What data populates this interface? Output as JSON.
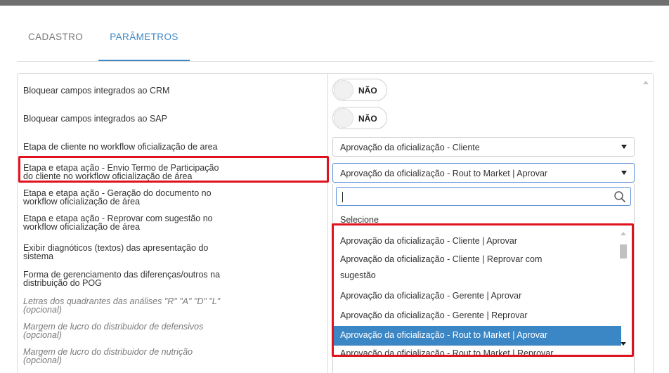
{
  "tabs": [
    {
      "label": "CADASTRO"
    },
    {
      "label": "PARÂMETROS"
    }
  ],
  "rows": [
    {
      "label_line1": "Bloquear campos integrados ao CRM",
      "label_line2": ""
    },
    {
      "label_line1": "Bloquear campos integrados ao SAP",
      "label_line2": ""
    },
    {
      "label_line1": "Etapa de cliente no workflow oficialização de area",
      "label_line2": ""
    },
    {
      "label_line1": "Etapa e etapa ação - Envio Termo de Participação",
      "label_line2": "do cliente no workflow oficialização de área"
    },
    {
      "label_line1": "Etapa e etapa ação - Geração do documento no",
      "label_line2": "workflow oficialização de área"
    },
    {
      "label_line1": "Etapa e etapa ação - Reprovar com sugestão no",
      "label_line2": "workflow oficialização de área"
    },
    {
      "label_line1": "Exibir diagnóticos (textos) das apresentação do",
      "label_line2": "sistema"
    },
    {
      "label_line1": "Forma de gerenciamento das diferenças/outros na",
      "label_line2": "distribuição do POG"
    },
    {
      "label_line1": "Letras dos quadrantes das análises \"R\" \"A\" \"D\" \"L\"",
      "label_line2": "(opcional)"
    },
    {
      "label_line1": "Margem de lucro do distribuidor de defensivos",
      "label_line2": "(opcional)"
    },
    {
      "label_line1": "Margem de lucro do distribuidor de nutrição",
      "label_line2": "(opcional)"
    }
  ],
  "toggles": [
    {
      "value": "NÃO"
    },
    {
      "value": "NÃO"
    }
  ],
  "selects": [
    {
      "value": "Aprovação da oficialização - Cliente"
    },
    {
      "value": "Aprovação da oficialização - Rout to Market | Aprovar"
    }
  ],
  "dropdown": {
    "search_value": "",
    "placeholder_option": "Selecione",
    "options": [
      "Aprovação da oficialização - Cliente | Aprovar",
      "Aprovação da oficialização - Cliente | Reprovar com",
      "sugestão",
      "Aprovação da oficialização - Gerente | Aprovar",
      "Aprovação da oficialização - Gerente | Reprovar",
      "Aprovação da oficialização - Rout to Market | Aprovar",
      "Aprovação da oficialização - Rout to Market | Reprovar"
    ],
    "selected_index": 5
  },
  "colors": {
    "accent": "#3b86c5",
    "highlight": "#e0121d"
  }
}
